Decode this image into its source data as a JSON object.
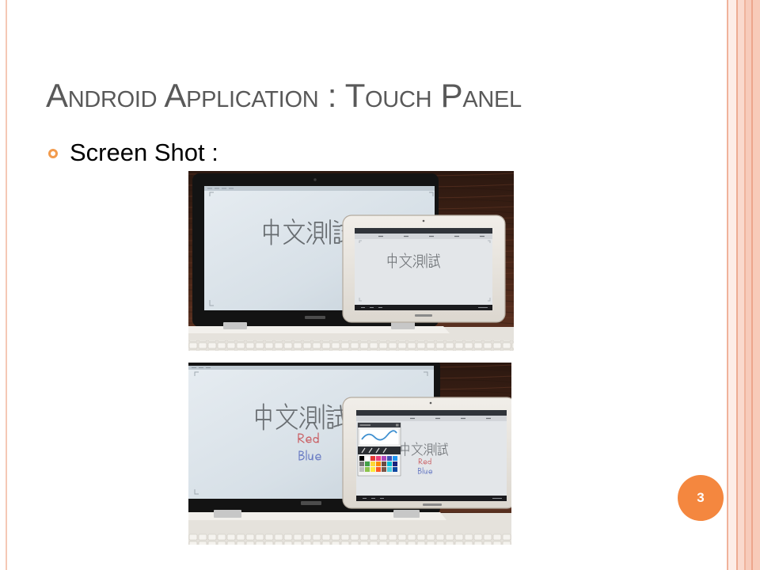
{
  "slide": {
    "title": "Android Application : Touch Panel",
    "bullet": "Screen Shot :",
    "page_number": "3"
  },
  "colors": {
    "title_text": "#595959",
    "bullet_marker": "#f29b4d",
    "page_badge": "#f4873f",
    "edge_stripe": "#f8cbb9"
  }
}
